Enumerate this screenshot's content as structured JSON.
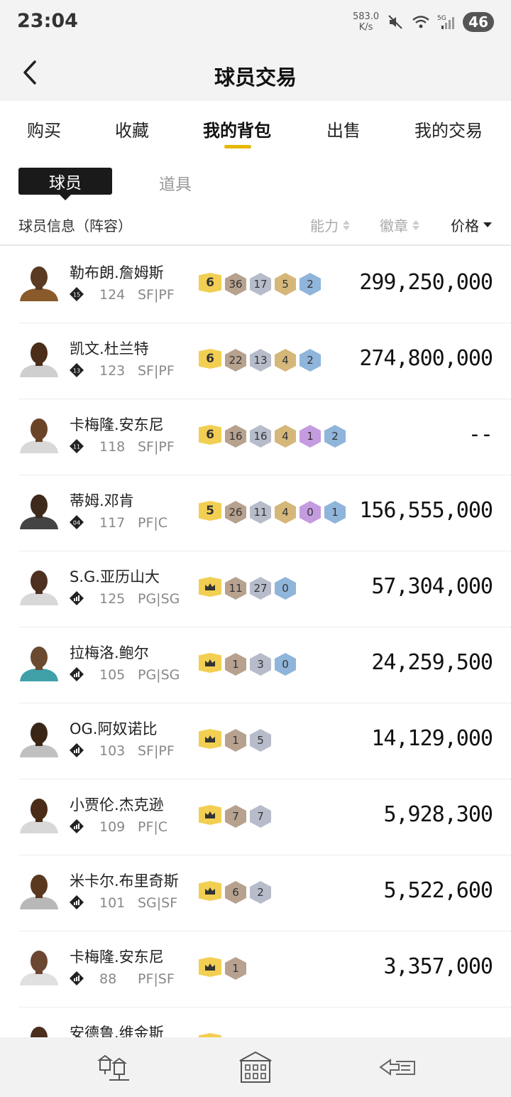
{
  "status_bar": {
    "time": "23:04",
    "net_speed_value": "583.0",
    "net_speed_unit": "K/s",
    "network": "5G",
    "battery": "46"
  },
  "header": {
    "title": "球员交易"
  },
  "tabs": [
    {
      "label": "购买",
      "active": false
    },
    {
      "label": "收藏",
      "active": false
    },
    {
      "label": "我的背包",
      "active": true
    },
    {
      "label": "出售",
      "active": false
    },
    {
      "label": "我的交易",
      "active": false
    }
  ],
  "sub_tabs": {
    "active": "球员",
    "other": "道具"
  },
  "columns": {
    "info": "球员信息（阵容）",
    "ability": "能力",
    "badge": "徽章",
    "price": "价格"
  },
  "players": [
    {
      "name": "勒布朗.詹姆斯",
      "tier": "15",
      "ovr": "124",
      "pos": "SF|PF",
      "level": "6",
      "badges": [
        {
          "v": "36",
          "c": "bronze"
        },
        {
          "v": "17",
          "c": "silver"
        },
        {
          "v": "5",
          "c": "gold"
        },
        {
          "v": "2",
          "c": "blue"
        }
      ],
      "price": "299,250,000"
    },
    {
      "name": "凯文.杜兰特",
      "tier": "13",
      "ovr": "123",
      "pos": "SF|PF",
      "level": "6",
      "badges": [
        {
          "v": "22",
          "c": "bronze"
        },
        {
          "v": "13",
          "c": "silver"
        },
        {
          "v": "4",
          "c": "gold"
        },
        {
          "v": "2",
          "c": "blue"
        }
      ],
      "price": "274,800,000"
    },
    {
      "name": "卡梅隆.安东尼",
      "tier": "11",
      "ovr": "118",
      "pos": "SF|PF",
      "level": "6",
      "badges": [
        {
          "v": "16",
          "c": "bronze"
        },
        {
          "v": "16",
          "c": "silver"
        },
        {
          "v": "4",
          "c": "gold"
        },
        {
          "v": "1",
          "c": "purple"
        },
        {
          "v": "2",
          "c": "blue"
        }
      ],
      "price": "--"
    },
    {
      "name": "蒂姆.邓肯",
      "tier": "04",
      "ovr": "117",
      "pos": "PF|C",
      "level": "5",
      "badges": [
        {
          "v": "26",
          "c": "bronze"
        },
        {
          "v": "11",
          "c": "silver"
        },
        {
          "v": "4",
          "c": "gold"
        },
        {
          "v": "0",
          "c": "purple"
        },
        {
          "v": "1",
          "c": "blue"
        }
      ],
      "price": "156,555,000"
    },
    {
      "name": "S.G.亚历山大",
      "tier": "",
      "ovr": "125",
      "pos": "PG|SG",
      "level": "crown",
      "badges": [
        {
          "v": "11",
          "c": "bronze"
        },
        {
          "v": "27",
          "c": "silver"
        },
        {
          "v": "0",
          "c": "blue"
        }
      ],
      "price": "57,304,000"
    },
    {
      "name": "拉梅洛.鲍尔",
      "tier": "",
      "ovr": "105",
      "pos": "PG|SG",
      "level": "crown",
      "badges": [
        {
          "v": "1",
          "c": "bronze"
        },
        {
          "v": "3",
          "c": "silver"
        },
        {
          "v": "0",
          "c": "blue"
        }
      ],
      "price": "24,259,500"
    },
    {
      "name": "OG.阿奴诺比",
      "tier": "",
      "ovr": "103",
      "pos": "SF|PF",
      "level": "crown",
      "badges": [
        {
          "v": "1",
          "c": "bronze"
        },
        {
          "v": "5",
          "c": "silver"
        }
      ],
      "price": "14,129,000"
    },
    {
      "name": "小贾伦.杰克逊",
      "tier": "",
      "ovr": "109",
      "pos": "PF|C",
      "level": "crown",
      "badges": [
        {
          "v": "7",
          "c": "bronze"
        },
        {
          "v": "7",
          "c": "silver"
        }
      ],
      "price": "5,928,300"
    },
    {
      "name": "米卡尔.布里奇斯",
      "tier": "",
      "ovr": "101",
      "pos": "SG|SF",
      "level": "crown",
      "badges": [
        {
          "v": "6",
          "c": "bronze"
        },
        {
          "v": "2",
          "c": "silver"
        }
      ],
      "price": "5,522,600"
    },
    {
      "name": "卡梅隆.安东尼",
      "tier": "",
      "ovr": "88",
      "pos": "PF|SF",
      "level": "crown",
      "badges": [
        {
          "v": "1",
          "c": "bronze"
        }
      ],
      "price": "3,357,000"
    },
    {
      "name": "安德鲁.维金斯",
      "tier": "",
      "ovr": "",
      "pos": "",
      "level": "crown",
      "badges": [],
      "price": ""
    }
  ],
  "bottom_nav": [
    "lamp-icon",
    "building-icon",
    "arrow-ticket-icon"
  ]
}
